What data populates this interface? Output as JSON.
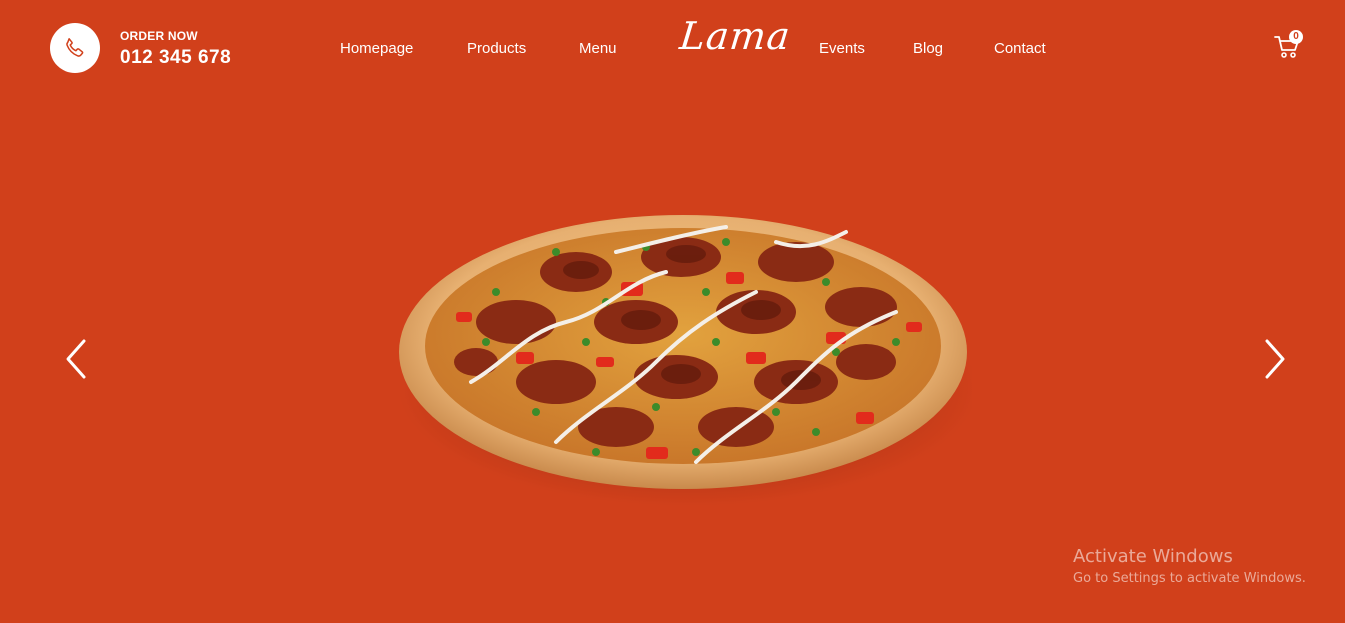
{
  "header": {
    "order_label": "ORDER NOW",
    "phone_number": "012 345 678",
    "logo": "Lama",
    "nav": [
      {
        "label": "Homepage"
      },
      {
        "label": "Products"
      },
      {
        "label": "Menu"
      },
      {
        "label": "Events"
      },
      {
        "label": "Blog"
      },
      {
        "label": "Contact"
      }
    ],
    "cart_count": "0"
  },
  "slider": {
    "image_icon": "pizza-image",
    "prev_icon": "chevron-left-icon",
    "next_icon": "chevron-right-icon"
  },
  "watermark": {
    "title": "Activate Windows",
    "subtitle": "Go to Settings to activate Windows."
  },
  "colors": {
    "background": "#d1401b",
    "text": "#ffffff"
  }
}
